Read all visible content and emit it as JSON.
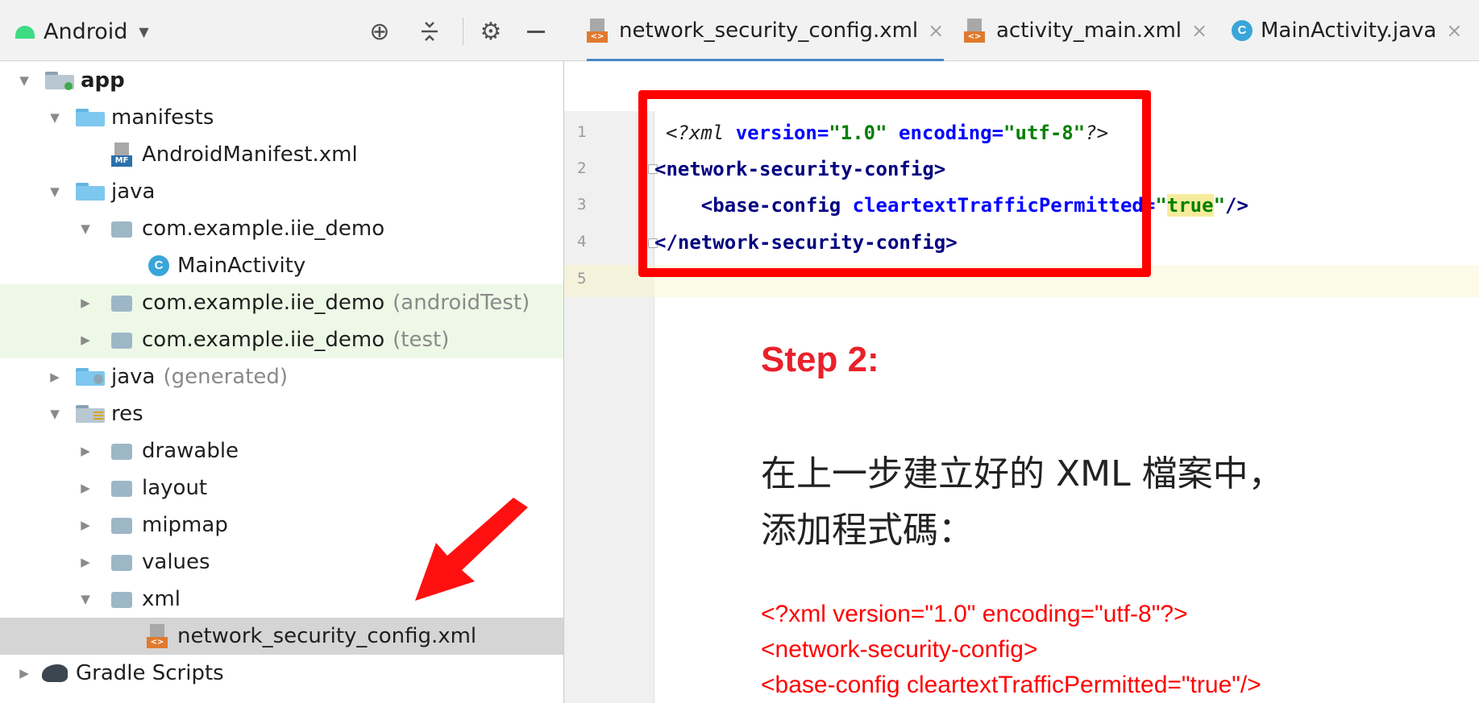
{
  "project_panel": {
    "view_selector": "Android",
    "tree": [
      {
        "label": "app",
        "bold": true
      },
      {
        "label": "manifests"
      },
      {
        "label": "AndroidManifest.xml",
        "icon": "manifest-file-icon"
      },
      {
        "label": "java"
      },
      {
        "label": "com.example.iie_demo"
      },
      {
        "label": "MainActivity",
        "icon": "java-class-icon"
      },
      {
        "label": "com.example.iie_demo",
        "suffix": "(androidTest)"
      },
      {
        "label": "com.example.iie_demo",
        "suffix": "(test)"
      },
      {
        "label": "java",
        "suffix": "(generated)"
      },
      {
        "label": "res"
      },
      {
        "label": "drawable"
      },
      {
        "label": "layout"
      },
      {
        "label": "mipmap"
      },
      {
        "label": "values"
      },
      {
        "label": "xml"
      },
      {
        "label": "network_security_config.xml",
        "icon": "xml-file-icon",
        "selected": true
      },
      {
        "label": "Gradle Scripts",
        "icon": "gradle-icon"
      }
    ],
    "icons": [
      "add-target-icon",
      "collapse-all-icon",
      "gear-icon",
      "minimize-icon"
    ]
  },
  "editor": {
    "tabs": [
      {
        "label": "network_security_config.xml",
        "active": true,
        "icon": "xml-file-icon"
      },
      {
        "label": "activity_main.xml",
        "active": false,
        "icon": "xml-file-icon"
      },
      {
        "label": "MainActivity.java",
        "active": false,
        "icon": "java-class-icon"
      }
    ],
    "line_numbers": [
      "1",
      "2",
      "3",
      "4",
      "5"
    ],
    "code": {
      "l1_open": "<?xml ",
      "l1_attr1": "version=",
      "l1_val1": "\"1.0\"",
      "l1_attr2": " encoding=",
      "l1_val2": "\"utf-8\"",
      "l1_close": "?>",
      "l2_tag": "<network-security-config>",
      "l3_indent": "    ",
      "l3_tag": "<base-config ",
      "l3_attr": "cleartextTrafficPermitted=",
      "l3_q1": "\"",
      "l3_val": "true",
      "l3_q2": "\"",
      "l3_close": "/>",
      "l4_tag": "</network-security-config>"
    }
  },
  "annotation": {
    "title": "Step 2:",
    "desc_line1": "在上一步建立好的 XML 檔案中，",
    "desc_line2": "添加程式碼：",
    "code_line1": "<?xml version=\"1.0\" encoding=\"utf-8\"?>",
    "code_line2": "<network-security-config>",
    "code_line3": "<base-config cleartextTrafficPermitted=\"true\"/>",
    "accent_color": "#ff0000"
  }
}
